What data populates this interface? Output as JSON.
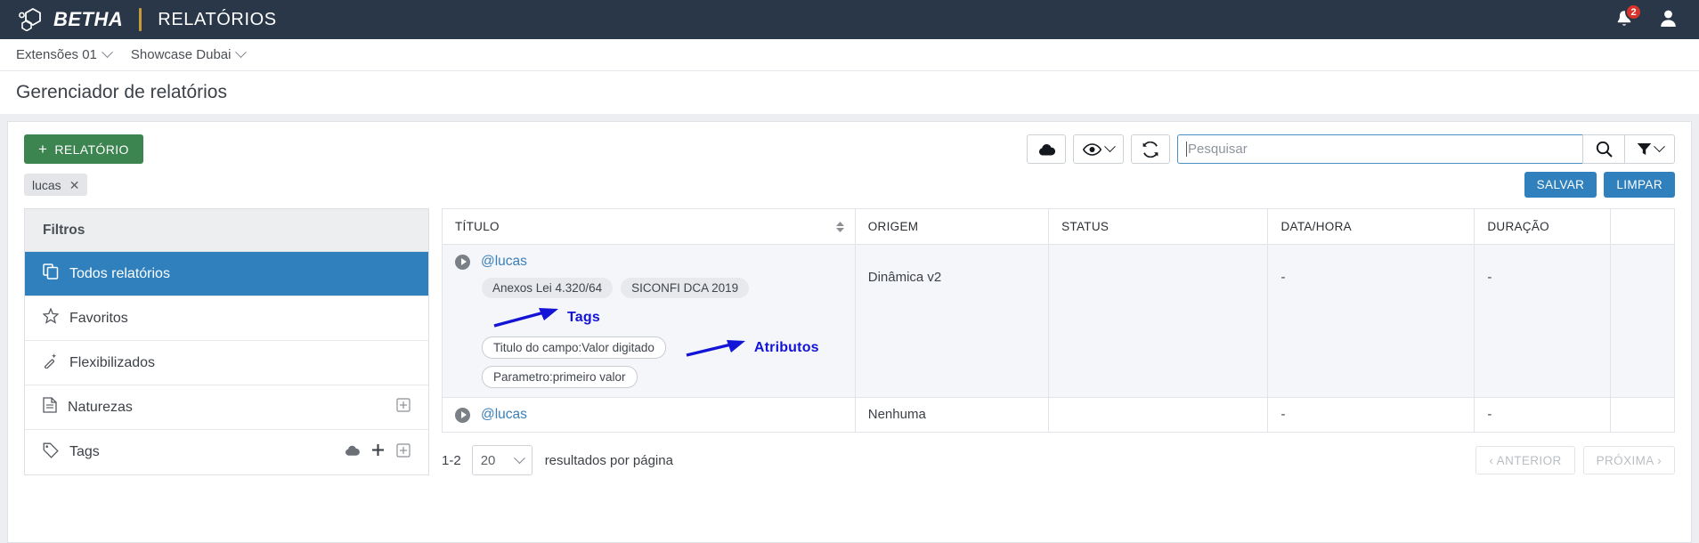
{
  "appbar": {
    "brand": "BETHA",
    "app_title": "RELATÓRIOS",
    "notification_count": "2",
    "accent_color": "#c99a39",
    "background_color": "#293748"
  },
  "breadcrumb": {
    "items": [
      {
        "label": "Extensões 01"
      },
      {
        "label": "Showcase Dubai"
      }
    ]
  },
  "page": {
    "title": "Gerenciador de relatórios"
  },
  "toolbar": {
    "new_report_label": "RELATÓRIO",
    "new_report_plus": "+",
    "new_report_color": "#3c8450",
    "upload_icon": "cloud-upload-icon",
    "visibility_icon": "eye-icon",
    "refresh_icon": "refresh-icon",
    "search_icon": "search-icon",
    "filter_icon": "funnel-icon",
    "save_label": "SALVAR",
    "clear_label": "LIMPAR",
    "primary_color": "#2f80bd"
  },
  "search": {
    "placeholder": "Pesquisar",
    "value": ""
  },
  "active_filter_chip": {
    "label": "lucas",
    "remove_icon": "close-icon"
  },
  "sidebar": {
    "header": "Filtros",
    "items": [
      {
        "label": "Todos relatórios",
        "icon": "copy-files-icon",
        "active": true
      },
      {
        "label": "Favoritos",
        "icon": "star-icon",
        "active": false
      },
      {
        "label": "Flexibilizados",
        "icon": "magic-wand-icon",
        "active": false
      },
      {
        "label": "Naturezas",
        "icon": "document-icon",
        "active": false
      },
      {
        "label": "Tags",
        "icon": "tag-icon",
        "active": false
      }
    ]
  },
  "table": {
    "columns": [
      "TÍTULO",
      "ORIGEM",
      "STATUS",
      "DATA/HORA",
      "DURAÇÃO",
      ""
    ],
    "rows": [
      {
        "title": "@lucas",
        "tags": [
          "Anexos Lei 4.320/64",
          "SICONFI DCA 2019"
        ],
        "attributes": [
          "Titulo do campo:Valor digitado",
          "Parametro:primeiro valor"
        ],
        "origem": "Dinâmica v2",
        "status": "",
        "data_hora": "-",
        "duracao": "-"
      },
      {
        "title": "@lucas",
        "tags": [],
        "attributes": [],
        "origem": "Nenhuma",
        "status": "",
        "data_hora": "-",
        "duracao": "-"
      }
    ]
  },
  "annotations": {
    "tags_label": "Tags",
    "attributes_label": "Atributos",
    "color": "#1414d6"
  },
  "pagination": {
    "range": "1-2",
    "per_page_value": "20",
    "per_page_label": "resultados por página",
    "prev_label": "‹ ANTERIOR",
    "next_label": "PRÓXIMA ›"
  }
}
